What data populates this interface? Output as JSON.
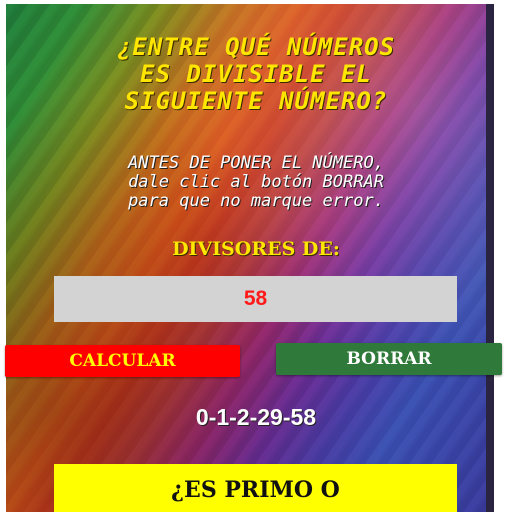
{
  "title": "¿ENTRE QUÉ NÚMEROS\nES DIVISIBLE EL\nSIGUIENTE NÚMERO?",
  "instructions": "ANTES DE PONER EL NÚMERO,\ndale clic al botón BORRAR\npara que no marque error.",
  "divisors_label": "DIVISORES DE:",
  "number_input": {
    "value": "58"
  },
  "buttons": {
    "calculate_label": "CALCULAR",
    "clear_label": "BORRAR"
  },
  "result": "0-1-2-29-58",
  "prime_question": "¿ES PRIMO O",
  "colors": {
    "title": "#ffe600",
    "input_text": "#ff1a1a",
    "input_bg": "#d3d3d3",
    "calculate_bg": "#ff0000",
    "calculate_text": "#ffff00",
    "clear_bg": "#2f7a3a",
    "clear_text": "#ffffff",
    "prime_bg": "#ffff00"
  }
}
